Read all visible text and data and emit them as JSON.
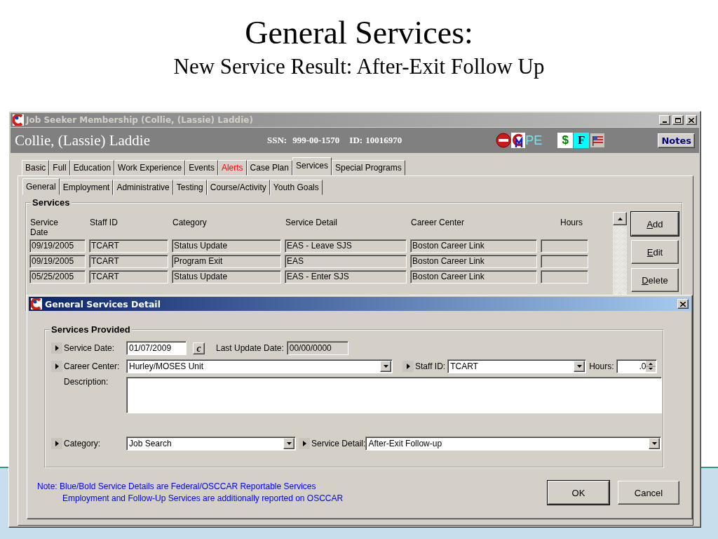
{
  "slide": {
    "title": "General Services:",
    "subtitle": "New Service Result: After-Exit Follow Up"
  },
  "window": {
    "title": "Job Seeker Membership (Collie, (Lassie) Laddie)",
    "person_name": "Collie, (Lassie) Laddie",
    "ssn_label": "SSN:",
    "ssn": "999-00-1570",
    "id_label": "ID:",
    "id": "10016970",
    "status_text": "PE",
    "badges": [
      {
        "text": "$",
        "color": "#ffffff"
      },
      {
        "text": "F",
        "color": "#00ffff"
      }
    ],
    "notes_button": "Notes"
  },
  "tabs": [
    {
      "label": "Basic",
      "selected": false,
      "color": "#000000"
    },
    {
      "label": "Full",
      "selected": false,
      "color": "#000000"
    },
    {
      "label": "Education",
      "selected": false,
      "color": "#000000"
    },
    {
      "label": "Work Experience",
      "selected": false,
      "color": "#000000"
    },
    {
      "label": "Events",
      "selected": false,
      "color": "#000000"
    },
    {
      "label": "Alerts",
      "selected": false,
      "color": "#ff0000"
    },
    {
      "label": "Case Plan",
      "selected": false,
      "color": "#000000"
    },
    {
      "label": "Services",
      "selected": true,
      "color": "#000000"
    },
    {
      "label": "Special Programs",
      "selected": false,
      "color": "#000000"
    }
  ],
  "subtabs": [
    {
      "label": "General",
      "selected": true
    },
    {
      "label": "Employment",
      "selected": false
    },
    {
      "label": "Administrative",
      "selected": false
    },
    {
      "label": "Testing",
      "selected": false
    },
    {
      "label": "Course/Activity",
      "selected": false
    },
    {
      "label": "Youth Goals",
      "selected": false
    }
  ],
  "services": {
    "title": "Services",
    "columns": [
      "Service Date",
      "Staff ID",
      "Category",
      "Service Detail",
      "Career Center",
      "Hours"
    ],
    "rows": [
      {
        "cells": [
          "09/19/2005",
          "TCART",
          "Status Update",
          "EAS - Leave SJS",
          "Boston Career Link"
        ]
      },
      {
        "cells": [
          "09/19/2005",
          "TCART",
          "Program Exit",
          "EAS",
          "Boston Career Link"
        ]
      },
      {
        "cells": [
          "05/25/2005",
          "TCART",
          "Status Update",
          "EAS - Enter SJS",
          "Boston Career Link"
        ]
      }
    ],
    "buttons": [
      "Add",
      "Edit",
      "Delete"
    ]
  },
  "dialog": {
    "title": "General Services Detail",
    "group_title": "Services Provided",
    "service_date": {
      "label": "Service Date:",
      "value": "01/07/2009",
      "required": true
    },
    "calendar_button": "c",
    "last_update": {
      "label": "Last Update Date:",
      "value": "00/00/0000"
    },
    "career_center": {
      "label": "Career Center:",
      "value": "Hurley/MOSES Unit",
      "required": true
    },
    "staff_id": {
      "label": "Staff ID:",
      "value": "TCART",
      "required": true
    },
    "hours": {
      "label": "Hours:",
      "value": ".0",
      "required": false
    },
    "description": {
      "label": "Description:",
      "required": false
    },
    "category": {
      "label": "Category:",
      "value": "Job Search",
      "required": true
    },
    "service_detail": {
      "label": "Service Detail:",
      "value": "After-Exit Follow-up",
      "required": true
    },
    "note": [
      "Note: Blue/Bold Service Details are Federal/OSCCAR Reportable Services",
      "Employment and Follow-Up Services are additionally reported on OSCCAR"
    ],
    "buttons": [
      "OK",
      "Cancel"
    ]
  }
}
